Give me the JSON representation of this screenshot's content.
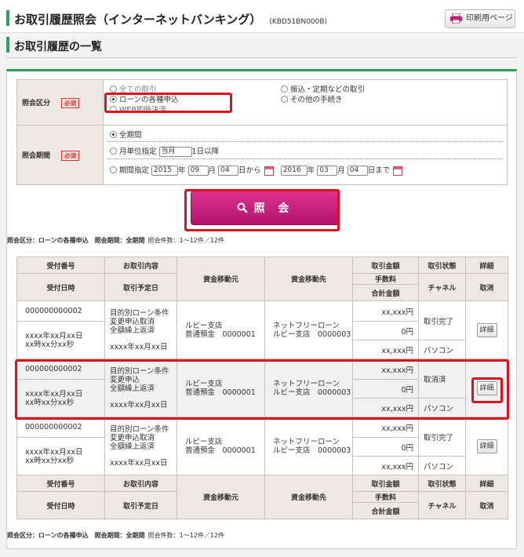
{
  "header": {
    "title": "お取引履歴照会（インターネットバンキング）",
    "code": "(KBD51BN000B)",
    "print_label": "印刷用ページ"
  },
  "section": {
    "subtitle": "お取引履歴の一覧"
  },
  "form": {
    "category": {
      "label": "照会区分",
      "required": "必須",
      "options": [
        "全ての取引",
        "ローンの各種申込",
        "WEB即時決済",
        "振込・定期などの取引",
        "その他の手続き"
      ],
      "selected": "ローンの各種申込"
    },
    "period": {
      "label": "照会期間",
      "required": "必須",
      "all": "全期間",
      "monthly": {
        "label": "月単位指定",
        "month": "当月",
        "suffix": "1日以降"
      },
      "range": {
        "label": "期間指定",
        "from_y": "2015",
        "from_m": "09",
        "from_d": "04",
        "to_y": "2016",
        "to_m": "03",
        "to_d": "04",
        "y": "年",
        "m": "月",
        "from_suffix": "日から",
        "to_suffix": "日まで"
      }
    },
    "search_label": "照 会"
  },
  "summary": {
    "text": "照会区分：ローンの各種申込　照会期間：全期間",
    "count": "照会件数：1～12件／12件"
  },
  "table": {
    "headers": {
      "receipt_no": "受付番号",
      "content": "お取引内容",
      "source": "資金移動元",
      "dest": "資金移動先",
      "amount": "取引金額",
      "status": "取引状態",
      "detail": "詳細",
      "receipt_time": "受付日時",
      "scheduled": "取引予定日",
      "fee": "手数料",
      "channel": "チャネル",
      "total": "合計金額",
      "cancel": "取消"
    },
    "rows": [
      {
        "no": "000000000002",
        "content": [
          "目的別ローン条件",
          "変更申込取消",
          "全額繰上返済"
        ],
        "datetime": [
          "xxxx年xx月xx日",
          "xx時xx分xx秒"
        ],
        "scheduled": "xxxx年xx月xx日",
        "source": [
          "ルビー支店",
          "普通預金　0000001"
        ],
        "dest": [
          "ネットフリーローン",
          "ルビー支店　0000003"
        ],
        "amount": "xx,xxx円",
        "fee": "0円",
        "total": "xx,xxx円",
        "status": "取引完了",
        "channel": "パソコン",
        "detail": "詳細"
      },
      {
        "no": "000000000002",
        "content": [
          "目的別ローン条件",
          "変更申込",
          "全額繰上返済"
        ],
        "datetime": [
          "xxxx年xx月xx日",
          "xx時xx分xx秒"
        ],
        "scheduled": "xxxx年xx月xx日",
        "source": [
          "ルビー支店",
          "普通預金　0000001"
        ],
        "dest": [
          "ネットフリーローン",
          "ルビー支店　0000003"
        ],
        "amount": "xx,xxx円",
        "fee": "0円",
        "total": "xx,xxx円",
        "status": "取消済",
        "channel": "パソコン",
        "detail": "詳細"
      },
      {
        "no": "000000000002",
        "content": [
          "目的別ローン条件",
          "変更申込取消",
          "全額繰上返済"
        ],
        "datetime": [
          "xxxx年xx月xx日",
          "xx時xx分xx秒"
        ],
        "scheduled": "xxxx年xx月xx日",
        "source": [
          "ルビー支店",
          "普通預金　0000001"
        ],
        "dest": [
          "ネットフリーローン",
          "ルビー支店　0000003"
        ],
        "amount": "xx,xxx円",
        "fee": "0円",
        "total": "xx,xxx円",
        "status": "取引完了",
        "channel": "パソコン",
        "detail": "詳細"
      }
    ]
  },
  "colors": {
    "accent": "#2aa058",
    "button": "#c8187a",
    "highlight": "#e0101a"
  }
}
